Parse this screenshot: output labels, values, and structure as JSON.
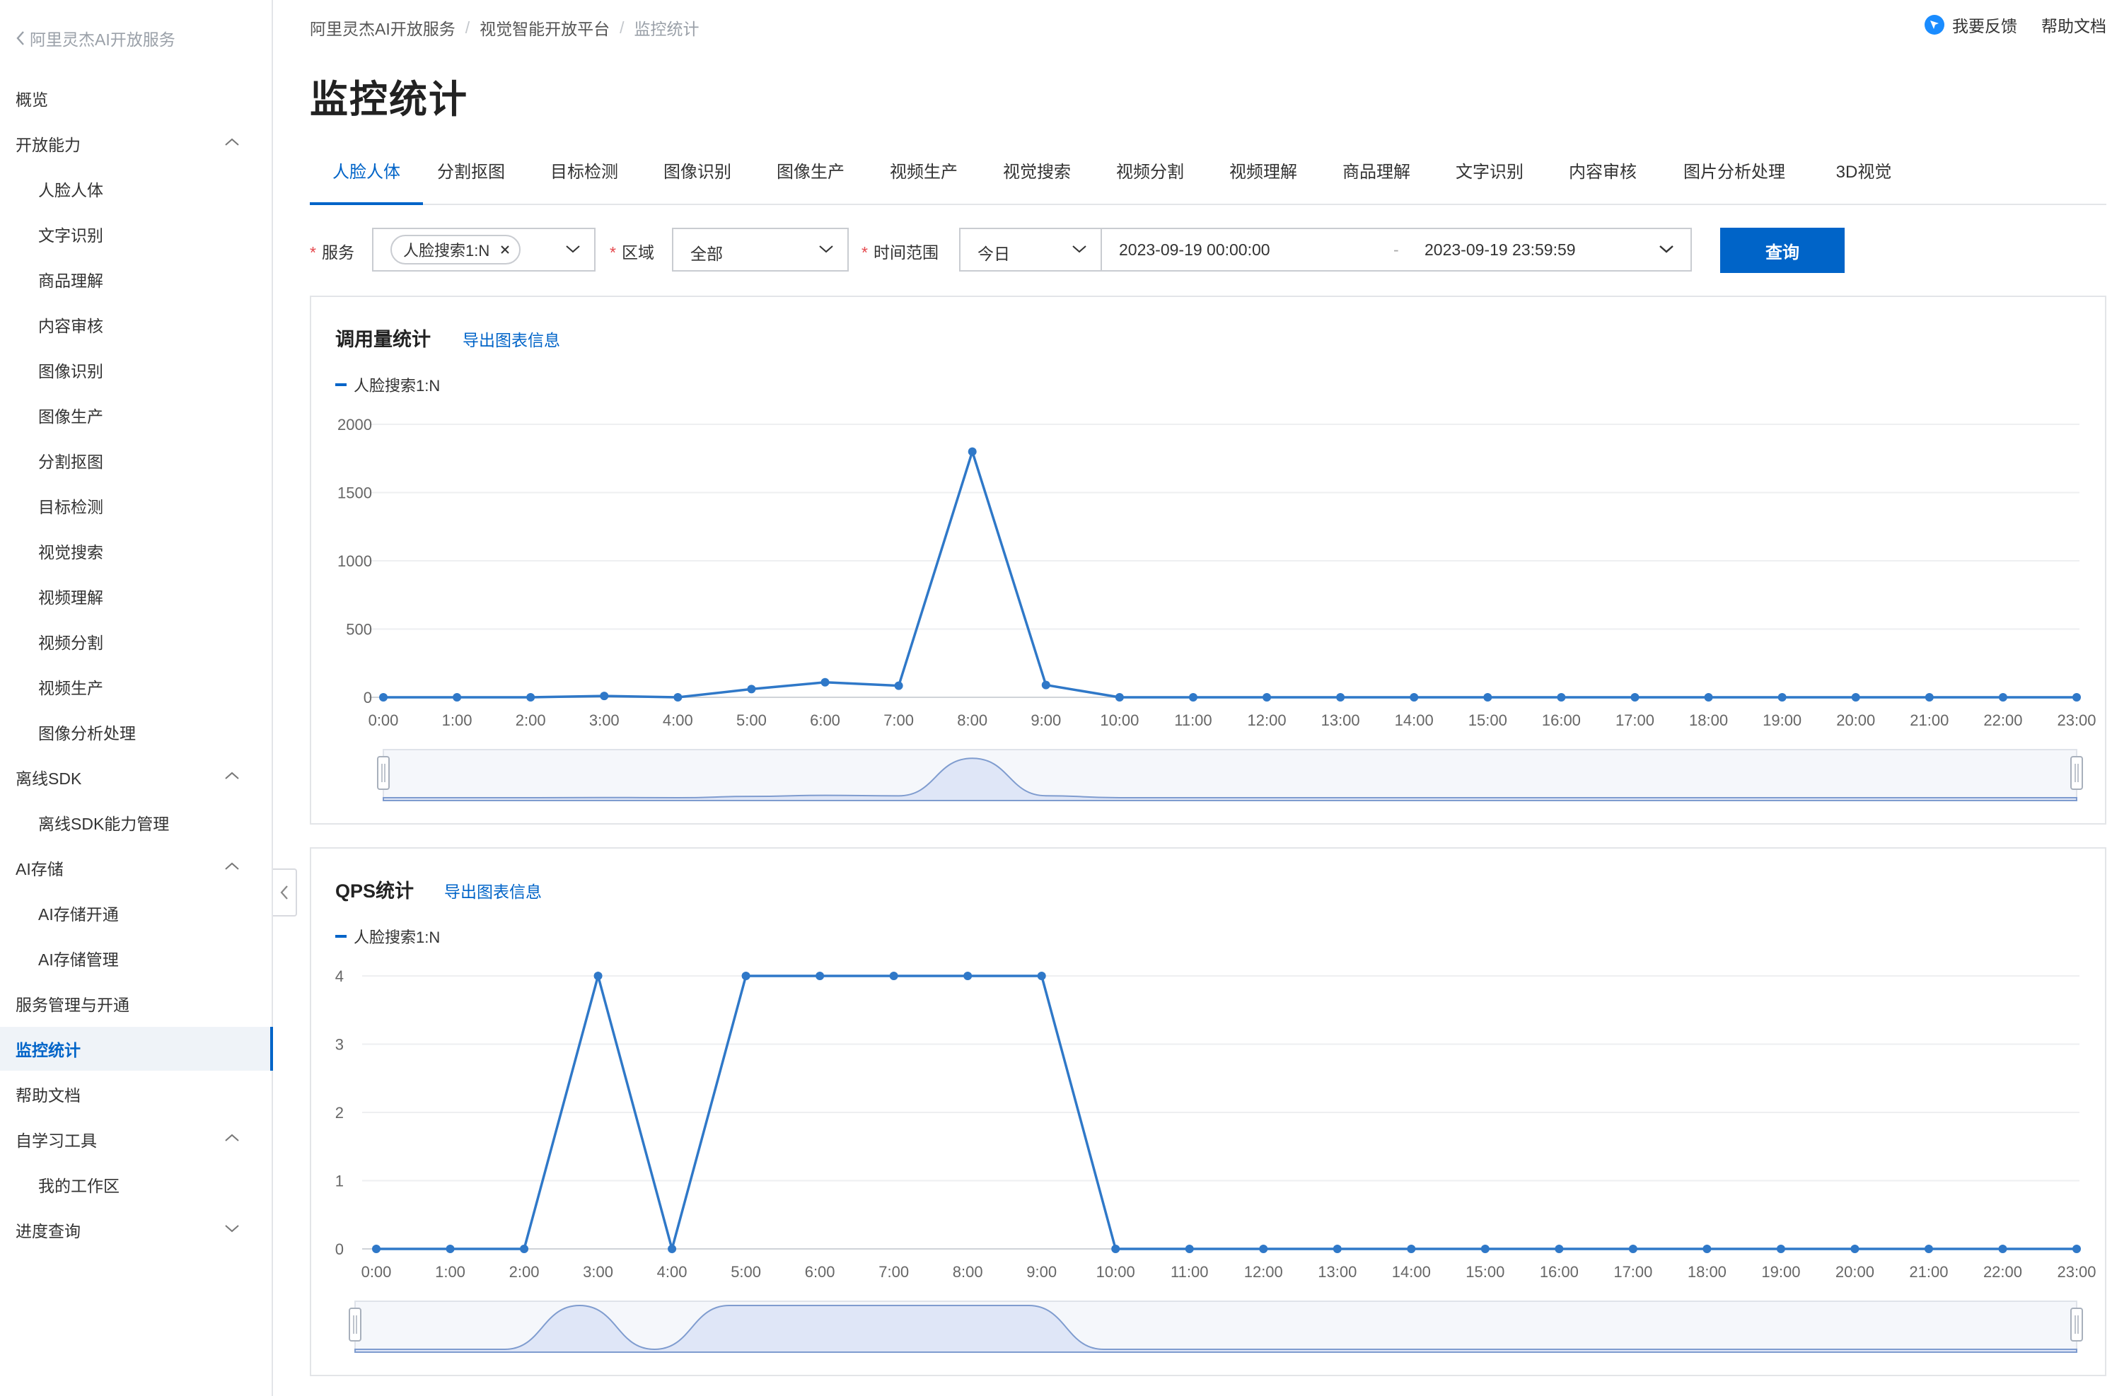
{
  "sidebar": {
    "back_label": "阿里灵杰AI开放服务",
    "items": [
      {
        "label": "概览",
        "level": 1
      },
      {
        "label": "开放能力",
        "level": 1,
        "chevron": "up"
      },
      {
        "label": "人脸人体",
        "level": 2
      },
      {
        "label": "文字识别",
        "level": 2
      },
      {
        "label": "商品理解",
        "level": 2
      },
      {
        "label": "内容审核",
        "level": 2
      },
      {
        "label": "图像识别",
        "level": 2
      },
      {
        "label": "图像生产",
        "level": 2
      },
      {
        "label": "分割抠图",
        "level": 2
      },
      {
        "label": "目标检测",
        "level": 2
      },
      {
        "label": "视觉搜索",
        "level": 2
      },
      {
        "label": "视频理解",
        "level": 2
      },
      {
        "label": "视频分割",
        "level": 2
      },
      {
        "label": "视频生产",
        "level": 2
      },
      {
        "label": "图像分析处理",
        "level": 2
      },
      {
        "label": "离线SDK",
        "level": 1,
        "chevron": "up"
      },
      {
        "label": "离线SDK能力管理",
        "level": 2
      },
      {
        "label": "AI存储",
        "level": 1,
        "chevron": "up"
      },
      {
        "label": "AI存储开通",
        "level": 2
      },
      {
        "label": "AI存储管理",
        "level": 2
      },
      {
        "label": "服务管理与开通",
        "level": 1
      },
      {
        "label": "监控统计",
        "level": 1,
        "active": true
      },
      {
        "label": "帮助文档",
        "level": 1
      },
      {
        "label": "自学习工具",
        "level": 1,
        "chevron": "up"
      },
      {
        "label": "我的工作区",
        "level": 2
      },
      {
        "label": "进度查询",
        "level": 1,
        "chevron": "down"
      }
    ]
  },
  "header": {
    "breadcrumb": [
      "阿里灵杰AI开放服务",
      "视觉智能开放平台",
      "监控统计"
    ],
    "feedback_label": "我要反馈",
    "help_label": "帮助文档",
    "title": "监控统计"
  },
  "tabs": [
    "人脸人体",
    "分割抠图",
    "目标检测",
    "图像识别",
    "图像生产",
    "视频生产",
    "视觉搜索",
    "视频分割",
    "视频理解",
    "商品理解",
    "文字识别",
    "内容审核",
    "图片分析处理",
    "3D视觉"
  ],
  "filters": {
    "service_label": "服务",
    "service_tag": "人脸搜索1:N",
    "region_label": "区域",
    "region_value": "全部",
    "time_label": "时间范围",
    "time_preset": "今日",
    "start_time": "2023-09-19 00:00:00",
    "range_sep": "-",
    "end_time": "2023-09-19 23:59:59",
    "query_label": "查询"
  },
  "colors": {
    "accent": "#0064c8",
    "series": "#2f78c8",
    "zoom_fill": "#dfe6f7"
  },
  "chart_data": [
    {
      "type": "line",
      "title": "调用量统计",
      "export_label": "导出图表信息",
      "x": [
        "0:00",
        "1:00",
        "2:00",
        "3:00",
        "4:00",
        "5:00",
        "6:00",
        "7:00",
        "8:00",
        "9:00",
        "10:00",
        "11:00",
        "12:00",
        "13:00",
        "14:00",
        "15:00",
        "16:00",
        "17:00",
        "18:00",
        "19:00",
        "20:00",
        "21:00",
        "22:00",
        "23:00"
      ],
      "yticks": [
        0,
        500,
        1000,
        1500,
        2000
      ],
      "ylim": [
        0,
        2000
      ],
      "series": [
        {
          "name": "人脸搜索1:N",
          "values": [
            0,
            0,
            0,
            10,
            0,
            60,
            110,
            85,
            1800,
            90,
            0,
            0,
            0,
            0,
            0,
            0,
            0,
            0,
            0,
            0,
            0,
            0,
            0,
            0
          ]
        }
      ],
      "grid": true,
      "legend": "top-left"
    },
    {
      "type": "line",
      "title": "QPS统计",
      "export_label": "导出图表信息",
      "x": [
        "0:00",
        "1:00",
        "2:00",
        "3:00",
        "4:00",
        "5:00",
        "6:00",
        "7:00",
        "8:00",
        "9:00",
        "10:00",
        "11:00",
        "12:00",
        "13:00",
        "14:00",
        "15:00",
        "16:00",
        "17:00",
        "18:00",
        "19:00",
        "20:00",
        "21:00",
        "22:00",
        "23:00"
      ],
      "yticks": [
        0,
        1,
        2,
        3,
        4
      ],
      "ylim": [
        0,
        4
      ],
      "series": [
        {
          "name": "人脸搜索1:N",
          "values": [
            0,
            0,
            0,
            4,
            0,
            4,
            4,
            4,
            4,
            4,
            0,
            0,
            0,
            0,
            0,
            0,
            0,
            0,
            0,
            0,
            0,
            0,
            0,
            0
          ]
        }
      ],
      "grid": true,
      "legend": "top-left"
    }
  ]
}
